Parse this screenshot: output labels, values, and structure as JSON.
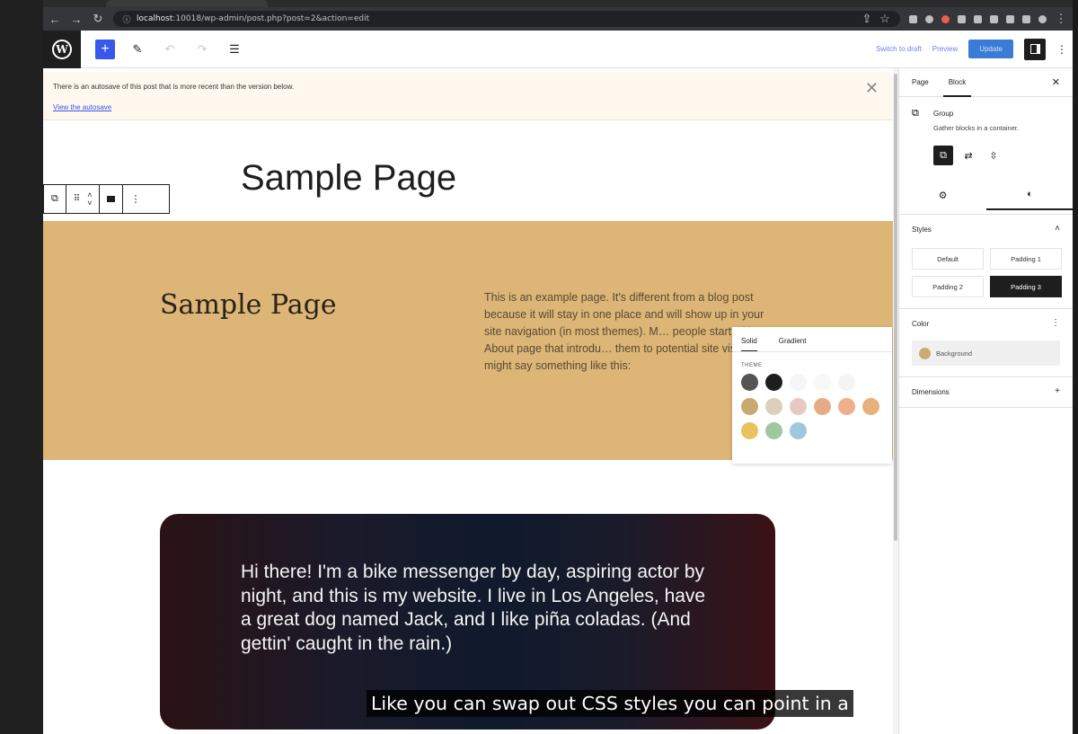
{
  "browser": {
    "url_host": "localhost",
    "url_rest": ":10018/wp-admin/post.php?post=2&action=edit"
  },
  "toolbar": {
    "switch_to_draft": "Switch to draft",
    "preview": "Preview",
    "update": "Update"
  },
  "notice": {
    "text": "There is an autosave of this post that is more recent than the version below.",
    "link": "View the autosave"
  },
  "canvas": {
    "page_title": "Sample Page",
    "group_heading": "Sample Page",
    "group_paragraph": "This is an example page. It's different from a blog post because it will stay in one place and will show up in your site navigation (in most themes). M… people start with an About page that introdu… them to potential site visitors. It might say something like this:",
    "quote": "Hi there! I'm a bike messenger by day, aspiring actor by night, and this is my website. I live in Los Angeles, have a great dog named Jack, and I like piña coladas. (And gettin' caught in the rain.)"
  },
  "color_popover": {
    "tab_solid": "Solid",
    "tab_gradient": "Gradient",
    "section": "THEME",
    "swatches": [
      "#555555",
      "#1e1e1e",
      "#f6f6f6",
      "#f8f8f8",
      "#f4f4f4",
      "#ffffff",
      "#c9aa6e",
      "#dcd0bc",
      "#e8c9bf",
      "#e6ab86",
      "#eeb08a",
      "#e8b07c",
      "#ebc15b",
      "#9fc8a0",
      "#9ec9dc"
    ]
  },
  "sidebar": {
    "tab_page": "Page",
    "tab_block": "Block",
    "block_name": "Group",
    "block_description": "Gather blocks in a container.",
    "styles_title": "Styles",
    "styles": [
      "Default",
      "Padding 1",
      "Padding 2",
      "Padding 3"
    ],
    "active_style": "Padding 3",
    "color_title": "Color",
    "background_label": "Background",
    "background_color": "#cdaa74",
    "dimensions_title": "Dimensions"
  },
  "caption": "Like you can swap out CSS styles you can point in a",
  "colors": {
    "group_background": "#dcb577",
    "wp_accent": "#3858e9"
  }
}
